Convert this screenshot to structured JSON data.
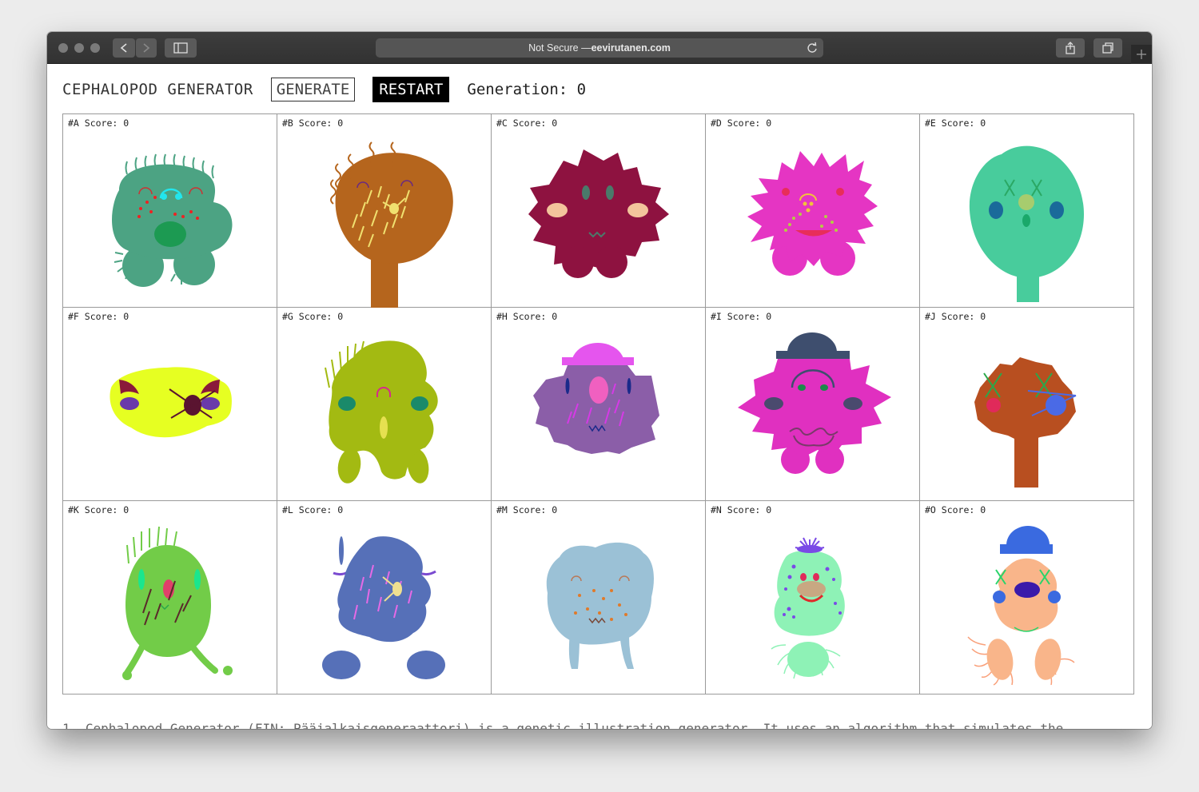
{
  "browser": {
    "address_prefix": "Not Secure — ",
    "address_domain": "eevirutanen.com"
  },
  "header": {
    "title": "CEPHALOPOD GENERATOR",
    "generate_label": "GENERATE",
    "restart_label": "RESTART",
    "generation_label": "Generation: 0"
  },
  "cells": [
    {
      "label": "#A Score: 0"
    },
    {
      "label": "#B Score: 0"
    },
    {
      "label": "#C Score: 0"
    },
    {
      "label": "#D Score: 0"
    },
    {
      "label": "#E Score: 0"
    },
    {
      "label": "#F Score: 0"
    },
    {
      "label": "#G Score: 0"
    },
    {
      "label": "#H Score: 0"
    },
    {
      "label": "#I Score: 0"
    },
    {
      "label": "#J Score: 0"
    },
    {
      "label": "#K Score: 0"
    },
    {
      "label": "#L Score: 0"
    },
    {
      "label": "#M Score: 0"
    },
    {
      "label": "#N Score: 0"
    },
    {
      "label": "#O Score: 0"
    }
  ],
  "footer_text": "1. Cephalopod Generator (FIN: Pääjalkaisgeneraattori) is a genetic illustration generator. It uses an algorithm that simulates the",
  "colors": {
    "A": "#4ca383",
    "B": "#b5651d",
    "C": "#8e1240",
    "D": "#e535c3",
    "E": "#48cc9c",
    "F": "#e6ff22",
    "G": "#a3ba12",
    "H": "#8b5ea8",
    "I": "#e030c0",
    "J": "#b84f20",
    "K": "#72cc48",
    "L": "#5670b8",
    "M": "#9bc1d6",
    "N": "#8ef2b6",
    "O": "#f9b58a"
  }
}
